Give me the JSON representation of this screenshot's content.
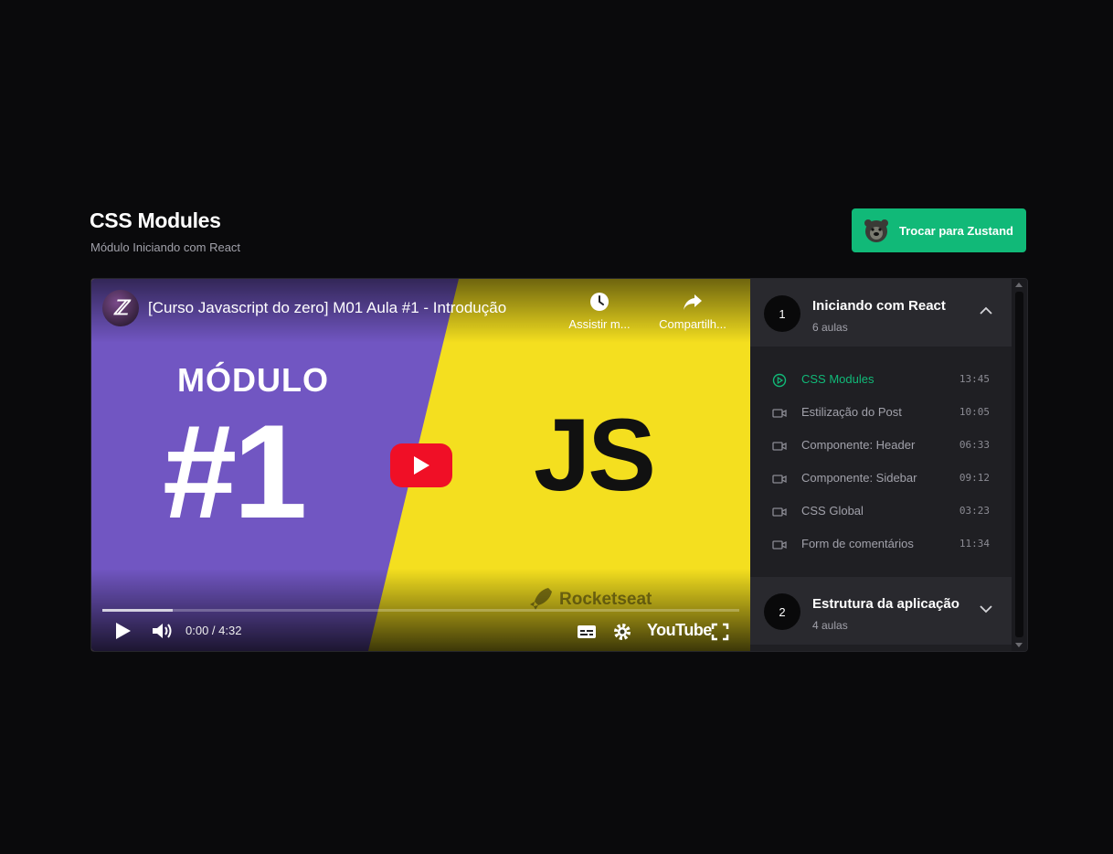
{
  "header": {
    "title": "CSS Modules",
    "subtitle": "Módulo Iniciando com React",
    "switch_button": "Trocar para Zustand"
  },
  "player": {
    "channel_avatar_text": "ℤ",
    "video_title": "[Curso Javascript do zero] M01 Aula #1 - Introdução",
    "watch_later_label": "Assistir m...",
    "share_label": "Compartilh...",
    "thumb_modulo": "MÓDULO",
    "thumb_number": "#1",
    "thumb_js": "JS",
    "thumb_brand": "Rocketseat",
    "time": "0:00 / 4:32",
    "progress_fraction": 0.11,
    "youtube_logo": "YouTube"
  },
  "sidebar": {
    "modules": [
      {
        "number": "1",
        "title": "Iniciando com React",
        "count": "6 aulas",
        "expanded": true
      },
      {
        "number": "2",
        "title": "Estrutura da aplicação",
        "count": "4 aulas",
        "expanded": false
      }
    ],
    "lessons": [
      {
        "title": "CSS Modules",
        "duration": "13:45",
        "active": true
      },
      {
        "title": "Estilização do Post",
        "duration": "10:05",
        "active": false
      },
      {
        "title": "Componente: Header",
        "duration": "06:33",
        "active": false
      },
      {
        "title": "Componente: Sidebar",
        "duration": "09:12",
        "active": false
      },
      {
        "title": "CSS Global",
        "duration": "03:23",
        "active": false
      },
      {
        "title": "Form de comentários",
        "duration": "11:34",
        "active": false
      }
    ]
  },
  "colors": {
    "background": "#0a0a0c",
    "accent_green": "#11b978",
    "purple": "#7156c2",
    "yellow": "#f4df1f",
    "youtube_red": "#f00f26"
  }
}
